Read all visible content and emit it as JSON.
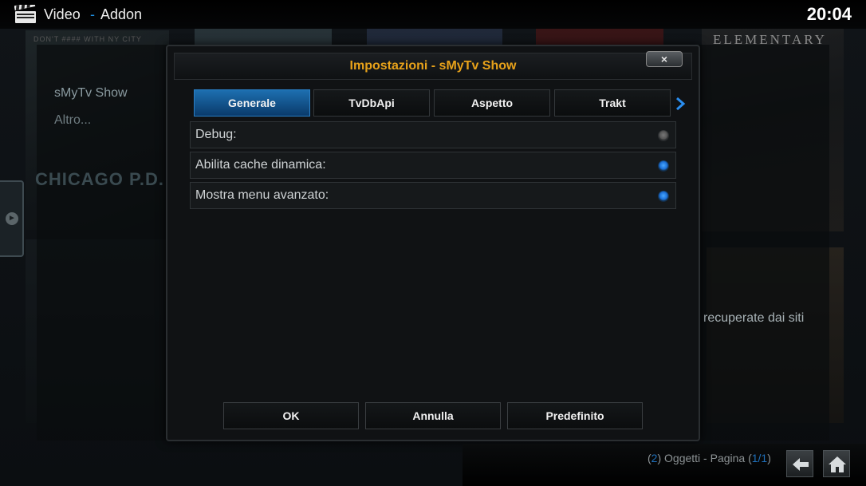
{
  "header": {
    "section": "Video",
    "separator": "-",
    "subsection": "Addon",
    "clock": "20:04",
    "section_icon": "clapperboard-icon"
  },
  "background": {
    "menu_items": [
      "sMyTv Show",
      "Altro..."
    ],
    "poster_titles": [
      "CHICAGO P.D.",
      "ELEMENTARY",
      "DON'T #### WITH NY CITY"
    ],
    "partial_text": "recuperate dai siti"
  },
  "dialog": {
    "title": "Impostazioni - sMyTv Show",
    "close_label": "×",
    "tabs": [
      {
        "label": "Generale",
        "active": true
      },
      {
        "label": "TvDbApi",
        "active": false
      },
      {
        "label": "Aspetto",
        "active": false
      },
      {
        "label": "Trakt",
        "active": false
      }
    ],
    "next_tab_icon": "chevron-right-icon",
    "settings": [
      {
        "label": "Debug:",
        "enabled": false
      },
      {
        "label": "Abilita cache dinamica:",
        "enabled": true
      },
      {
        "label": "Mostra menu avanzato:",
        "enabled": true
      }
    ],
    "buttons": {
      "ok": "OK",
      "cancel": "Annulla",
      "default": "Predefinito"
    }
  },
  "footer": {
    "open_paren": "(",
    "items_count": "2",
    "items_text": ") Oggetti - Pagina (",
    "page": "1/1",
    "close_paren": ")",
    "back_icon": "back-arrow-icon",
    "home_icon": "home-icon"
  },
  "colors": {
    "accent": "#1f8ee0",
    "title": "#e8a21a",
    "active_tab": "#1d6fb0"
  }
}
